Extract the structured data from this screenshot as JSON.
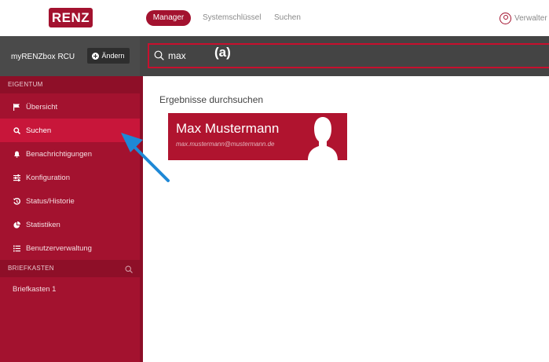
{
  "brand": {
    "logo_text": "RENZ",
    "accent": "#a3122f"
  },
  "topnav": {
    "items": [
      {
        "label": "Manager",
        "active": true
      },
      {
        "label": "Systemschlüssel",
        "active": false
      },
      {
        "label": "Suchen",
        "active": false
      }
    ],
    "user_label": "Verwalter"
  },
  "box": {
    "name": "myRENZbox RCU",
    "change_label": "Ändern"
  },
  "search": {
    "value": "max",
    "annotation": "(a)"
  },
  "sidebar": {
    "section1": "EIGENTUM",
    "items": [
      {
        "label": "Übersicht",
        "icon": "flag-icon"
      },
      {
        "label": "Suchen",
        "icon": "search-icon",
        "active": true
      },
      {
        "label": "Benachrichtigungen",
        "icon": "bell-icon"
      },
      {
        "label": "Konfiguration",
        "icon": "sliders-icon"
      },
      {
        "label": "Status/Historie",
        "icon": "history-icon"
      },
      {
        "label": "Statistiken",
        "icon": "pie-chart-icon"
      },
      {
        "label": "Benutzerverwaltung",
        "icon": "list-icon"
      }
    ],
    "section2": "BRIEFKASTEN",
    "mailbox_items": [
      {
        "label": "Briefkasten 1"
      }
    ]
  },
  "main": {
    "title": "Ergebnisse durchsuchen",
    "result": {
      "name": "Max Mustermann",
      "email": "max.mustermann@mustermann.de"
    }
  }
}
